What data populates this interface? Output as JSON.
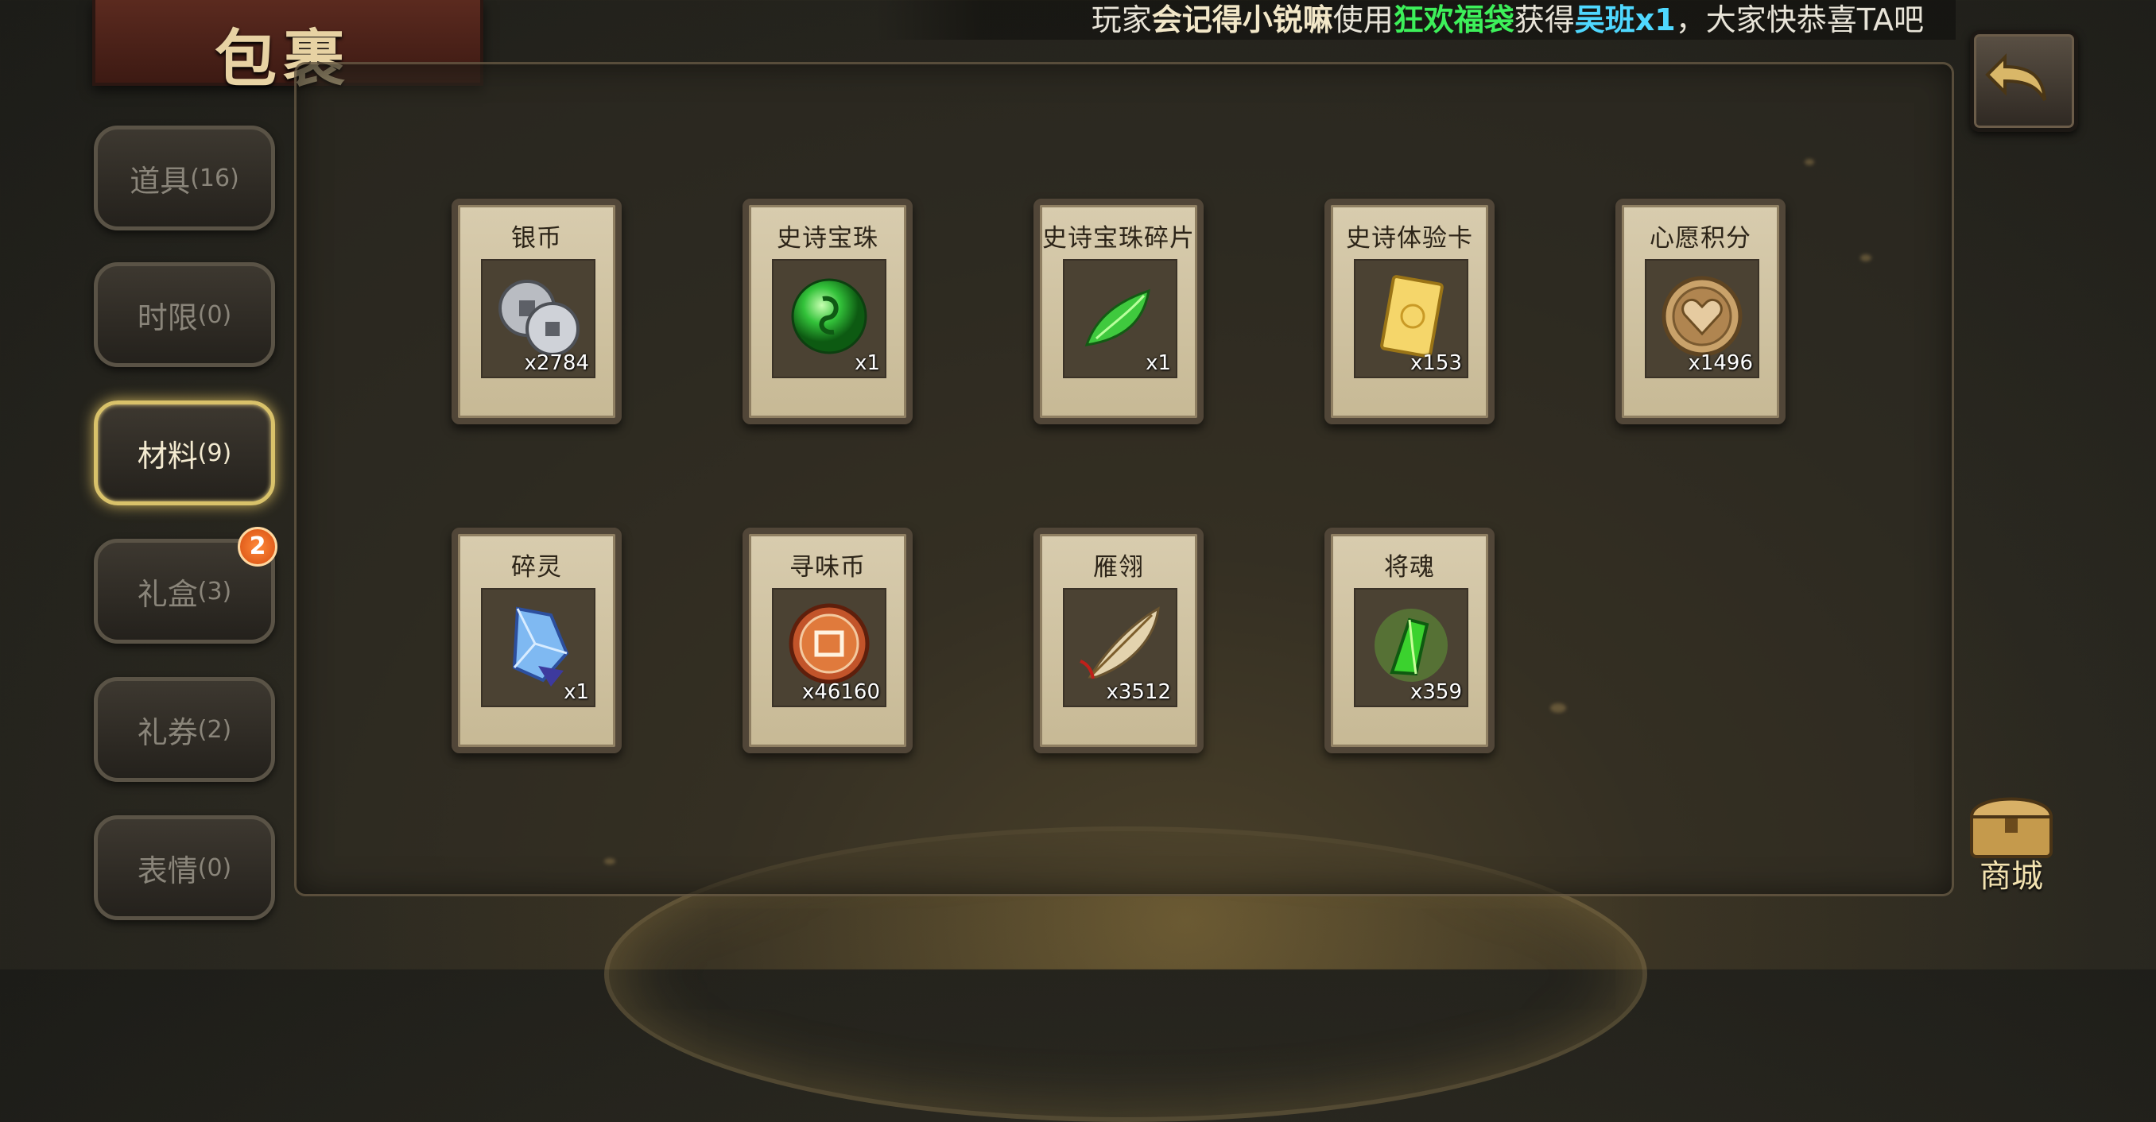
{
  "header": {
    "title": "包裹"
  },
  "broadcast": {
    "prefix": "玩家",
    "player": "会记得小锐嘛",
    "verb": "使用",
    "item_used": "狂欢福袋",
    "obtained": "获得",
    "reward": "吴班x1",
    "suffix": "，大家快恭喜TA吧"
  },
  "tabs": [
    {
      "label": "道具",
      "count": "(16)",
      "active": false,
      "badge": null
    },
    {
      "label": "时限",
      "count": "(0)",
      "active": false,
      "badge": null
    },
    {
      "label": "材料",
      "count": "(9)",
      "active": true,
      "badge": null
    },
    {
      "label": "礼盒",
      "count": "(3)",
      "active": false,
      "badge": "2"
    },
    {
      "label": "礼券",
      "count": "(2)",
      "active": false,
      "badge": null
    },
    {
      "label": "表情",
      "count": "(0)",
      "active": false,
      "badge": null
    }
  ],
  "items": [
    {
      "name": "银币",
      "qty": "x2784",
      "icon": "silver-coins-icon"
    },
    {
      "name": "史诗宝珠",
      "qty": "x1",
      "icon": "epic-orb-icon"
    },
    {
      "name": "史诗宝珠碎片",
      "qty": "x1",
      "icon": "orb-shard-icon"
    },
    {
      "name": "史诗体验卡",
      "qty": "x153",
      "icon": "trial-card-icon"
    },
    {
      "name": "心愿积分",
      "qty": "x1496",
      "icon": "wish-points-icon"
    },
    {
      "name": "碎灵",
      "qty": "x1",
      "icon": "spirit-crystal-icon"
    },
    {
      "name": "寻味币",
      "qty": "x46160",
      "icon": "taste-coin-icon"
    },
    {
      "name": "雁翎",
      "qty": "x3512",
      "icon": "feather-icon"
    },
    {
      "name": "将魂",
      "qty": "x359",
      "icon": "general-soul-icon"
    }
  ],
  "shop": {
    "label": "商城"
  },
  "colors": {
    "accent_green": "#3df05a",
    "accent_cyan": "#4fd8ff",
    "active_tab_glow": "#d9c26a"
  }
}
